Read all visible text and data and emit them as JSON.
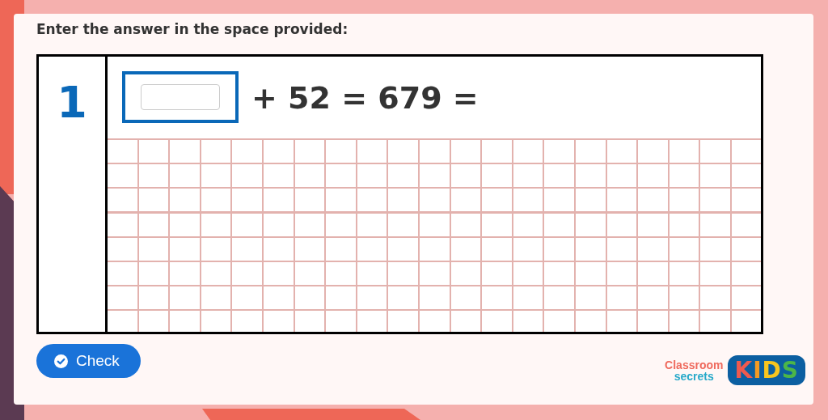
{
  "instruction": "Enter the answer in the space provided:",
  "question": {
    "number": "1",
    "equation": "+ 52 = 679 ="
  },
  "check_button": {
    "label": "Check"
  },
  "logo": {
    "brand_top": "Classroom",
    "brand_bottom": "secrets",
    "badge": "KIDS"
  }
}
